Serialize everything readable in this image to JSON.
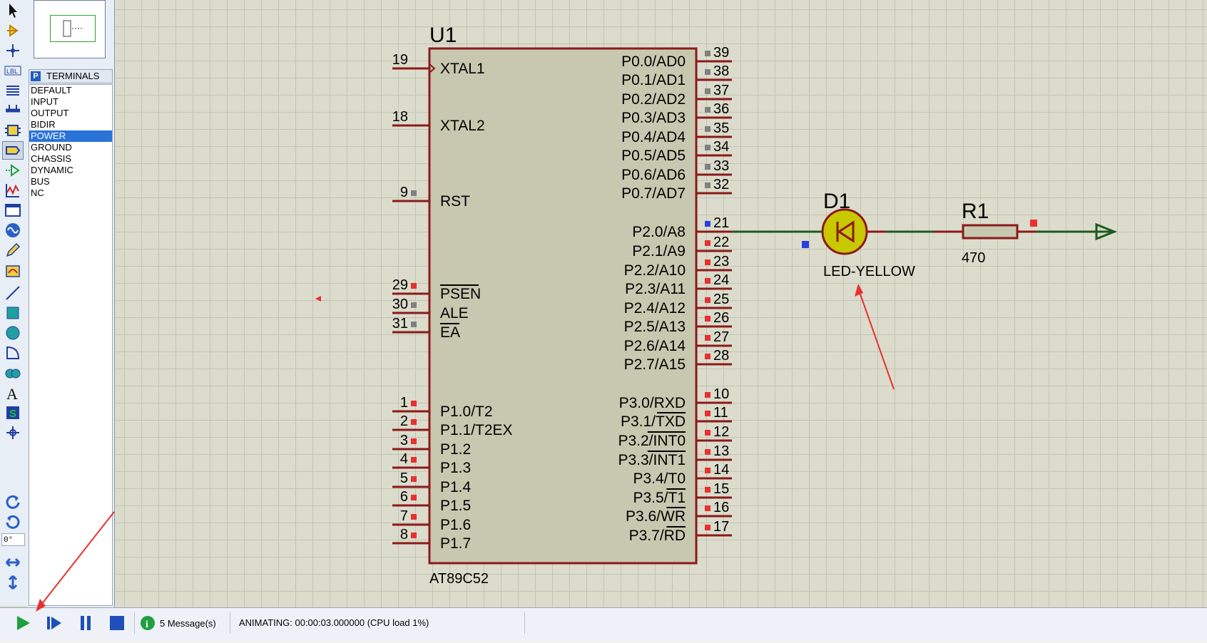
{
  "tools": [
    "select-tool",
    "component-tool",
    "junction-tool",
    "wire-label-tool",
    "text-script-tool",
    "bus-tool",
    "subcircuit-tool",
    "terminals-tool",
    "device-pins-tool",
    "graph-tool",
    "tape-recorder-tool",
    "generator-tool",
    "voltage-probe-tool",
    "virtual-instruments-tool",
    "line-tool",
    "box-tool",
    "circle-tool",
    "arc-tool",
    "path-tool",
    "text-tool",
    "symbol-tool",
    "marker-tool",
    "rotate-clockwise",
    "rotate-anticlockwise",
    "mirror-horizontal",
    "mirror-vertical"
  ],
  "rotation_value": "0°",
  "terminals": {
    "badge": "P",
    "title": "TERMINALS",
    "items": [
      "DEFAULT",
      "INPUT",
      "OUTPUT",
      "BIDIR",
      "POWER",
      "GROUND",
      "CHASSIS",
      "DYNAMIC",
      "BUS",
      "NC"
    ],
    "selected": "POWER"
  },
  "schematic": {
    "chip": {
      "ref": "U1",
      "part": "AT89C52",
      "left_pins": [
        {
          "num": "19",
          "label": "XTAL1"
        },
        {
          "num": "18",
          "label": "XTAL2"
        },
        {
          "num": "9",
          "label": "RST"
        },
        {
          "num": "29",
          "label": "PSEN"
        },
        {
          "num": "30",
          "label": "ALE"
        },
        {
          "num": "31",
          "label": "EA"
        },
        {
          "num": "1",
          "label": "P1.0/T2"
        },
        {
          "num": "2",
          "label": "P1.1/T2EX"
        },
        {
          "num": "3",
          "label": "P1.2"
        },
        {
          "num": "4",
          "label": "P1.3"
        },
        {
          "num": "5",
          "label": "P1.4"
        },
        {
          "num": "6",
          "label": "P1.5"
        },
        {
          "num": "7",
          "label": "P1.6"
        },
        {
          "num": "8",
          "label": "P1.7"
        }
      ],
      "right_pins": [
        {
          "num": "39",
          "label": "P0.0/AD0"
        },
        {
          "num": "38",
          "label": "P0.1/AD1"
        },
        {
          "num": "37",
          "label": "P0.2/AD2"
        },
        {
          "num": "36",
          "label": "P0.3/AD3"
        },
        {
          "num": "35",
          "label": "P0.4/AD4"
        },
        {
          "num": "34",
          "label": "P0.5/AD5"
        },
        {
          "num": "33",
          "label": "P0.6/AD6"
        },
        {
          "num": "32",
          "label": "P0.7/AD7"
        },
        {
          "num": "21",
          "label": "P2.0/A8"
        },
        {
          "num": "22",
          "label": "P2.1/A9"
        },
        {
          "num": "23",
          "label": "P2.2/A10"
        },
        {
          "num": "24",
          "label": "P2.3/A11"
        },
        {
          "num": "25",
          "label": "P2.4/A12"
        },
        {
          "num": "26",
          "label": "P2.5/A13"
        },
        {
          "num": "27",
          "label": "P2.6/A14"
        },
        {
          "num": "28",
          "label": "P2.7/A15"
        },
        {
          "num": "10",
          "label": "P3.0/RXD"
        },
        {
          "num": "11",
          "label": "P3.1/TXD"
        },
        {
          "num": "12",
          "label": "P3.2/INT0"
        },
        {
          "num": "13",
          "label": "P3.3/INT1"
        },
        {
          "num": "14",
          "label": "P3.4/T0"
        },
        {
          "num": "15",
          "label": "P3.5/T1"
        },
        {
          "num": "16",
          "label": "P3.6/WR"
        },
        {
          "num": "17",
          "label": "P3.7/RD"
        }
      ]
    },
    "led": {
      "ref": "D1",
      "value": "LED-YELLOW",
      "color": "#c8c800"
    },
    "resistor": {
      "ref": "R1",
      "value": "470"
    },
    "wire_color": "#1f5a1f",
    "pin_color": "#8b1a1a",
    "body_color": "#c8c8b0"
  },
  "status": {
    "message_count": "5 Message(s)",
    "animation": "ANIMATING: 00:00:03.000000 (CPU load 1%)"
  }
}
